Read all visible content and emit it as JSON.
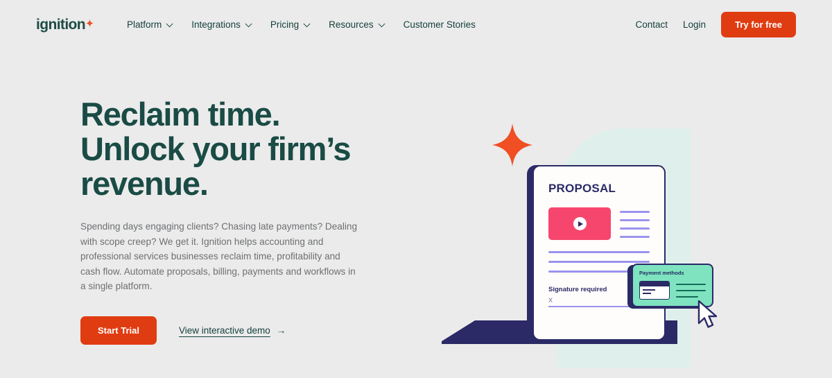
{
  "brand": {
    "logo_word": "ignition",
    "logo_star_icon": "four-point-star-icon",
    "accent_red": "#e03c11",
    "accent_orange": "#f04e23",
    "dark_teal": "#1a4b45",
    "navy": "#2b2a66",
    "mint": "#7fe3c0",
    "pale_mint": "#dff0ec",
    "page_bg": "#ebebeb",
    "purple": "#9b93ef",
    "pink": "#f7466e"
  },
  "nav": {
    "items": [
      {
        "label": "Platform",
        "has_chevron": true
      },
      {
        "label": "Integrations",
        "has_chevron": true
      },
      {
        "label": "Pricing",
        "has_chevron": true
      },
      {
        "label": "Resources",
        "has_chevron": true
      },
      {
        "label": "Customer Stories",
        "has_chevron": false
      }
    ],
    "contact_label": "Contact",
    "login_label": "Login",
    "cta_label": "Try for free"
  },
  "hero": {
    "headline_line1": "Reclaim time.",
    "headline_line2": "Unlock your firm’s",
    "headline_line3": "revenue.",
    "paragraph": "Spending days engaging clients? Chasing late payments? Dealing with scope creep? We get it. Ignition helps accounting and professional services businesses reclaim time, profitability and cash flow. Automate proposals, billing, payments and workflows in a single platform.",
    "primary_cta": "Start Trial",
    "secondary_cta": "View interactive demo",
    "secondary_cta_arrow": "→"
  },
  "illustration": {
    "star_icon": "four-point-star-icon",
    "document": {
      "title": "PROPOSAL",
      "video_icon": "play-button-icon",
      "signature_label": "Signature required",
      "signature_mark": "X"
    },
    "payment_card": {
      "title": "Payment methods",
      "card_icon": "credit-card-icon"
    },
    "cursor_icon": "mouse-pointer-icon",
    "laptop_icon": "laptop-base-icon"
  }
}
